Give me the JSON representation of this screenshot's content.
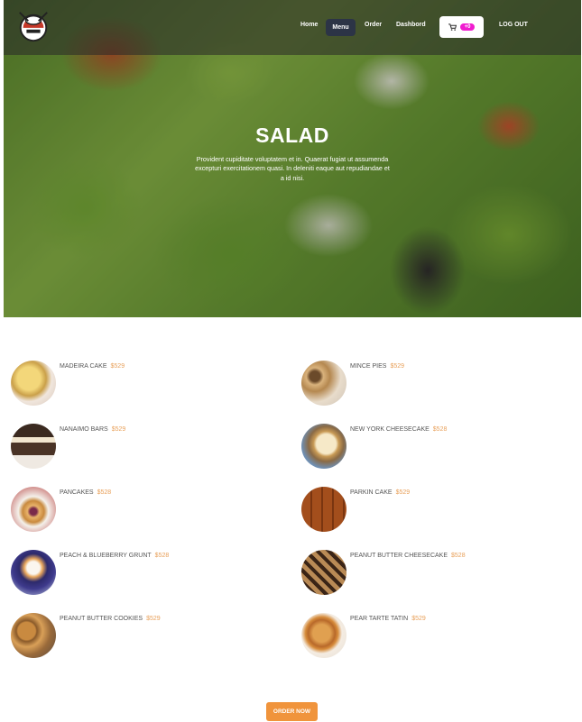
{
  "nav": {
    "home": "Home",
    "menu": "Menu",
    "order": "Order",
    "dashboard": "Dashbord",
    "cart_count": "+0",
    "logout": "LOG OUT"
  },
  "hero": {
    "title": "SALAD",
    "description": "Provident cupiditate voluptatem et in. Quaerat fugiat ut assumenda excepturi exercitationem quasi. In deleniti eaque aut repudiandae et a id nisi."
  },
  "menu_items": [
    {
      "name": "MADEIRA CAKE",
      "price": "$529"
    },
    {
      "name": "MINCE PIES",
      "price": "$529"
    },
    {
      "name": "NANAIMO BARS",
      "price": "$529"
    },
    {
      "name": "NEW YORK CHEESECAKE",
      "price": "$528"
    },
    {
      "name": "PANCAKES",
      "price": "$528"
    },
    {
      "name": "PARKIN CAKE",
      "price": "$529"
    },
    {
      "name": "PEACH & BLUEBERRY GRUNT",
      "price": "$528"
    },
    {
      "name": "PEANUT BUTTER CHEESECAKE",
      "price": "$528"
    },
    {
      "name": "PEANUT BUTTER COOKIES",
      "price": "$529"
    },
    {
      "name": "PEAR TARTE TATIN",
      "price": "$529"
    }
  ],
  "order_button": "ORDER NOW",
  "colors": {
    "accent": "#f0943c",
    "price": "#e8a05a",
    "badge": "#e91ec9",
    "active_nav": "#2c3445"
  }
}
